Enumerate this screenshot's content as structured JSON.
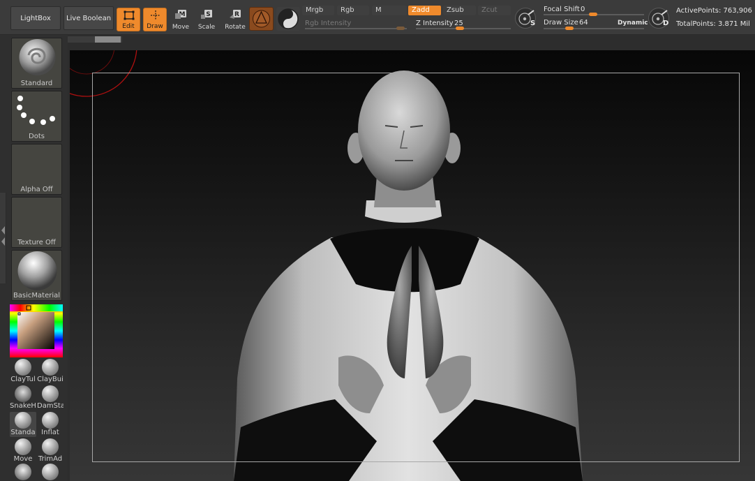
{
  "toolbar": {
    "lightbox": "LightBox",
    "live_boolean": "Live Boolean",
    "tools": [
      {
        "label": "Edit",
        "active": true
      },
      {
        "label": "Draw",
        "active": true
      },
      {
        "label": "Move",
        "active": false
      },
      {
        "label": "Scale",
        "active": false
      },
      {
        "label": "Rotate",
        "active": false
      }
    ],
    "modes": {
      "mrgb": "Mrgb",
      "rgb": "Rgb",
      "m": "M",
      "zadd": "Zadd",
      "zsub": "Zsub",
      "zcut": "Zcut"
    },
    "rgb_intensity_label": "Rgb Intensity",
    "z_intensity_label": "Z Intensity",
    "z_intensity_value": "25",
    "focal_shift_label": "Focal Shift",
    "focal_shift_value": "0",
    "draw_size_label": "Draw Size",
    "draw_size_value": "64",
    "dynamic_label": "Dynamic",
    "active_points": "ActivePoints: 763,906",
    "total_points": "TotalPoints: 3.871 Mil",
    "s_button": "S",
    "d_button": "D"
  },
  "shelf": {
    "brush": "Standard",
    "stroke": "Dots",
    "alpha": "Alpha Off",
    "texture": "Texture Off",
    "material": "BasicMaterial"
  },
  "brushes": [
    {
      "name": "ClayTul"
    },
    {
      "name": "ClayBui"
    },
    {
      "name": "SnakeH"
    },
    {
      "name": "DamSta"
    },
    {
      "name": "Standa"
    },
    {
      "name": "Inflat"
    },
    {
      "name": "Move"
    },
    {
      "name": "TrimAd"
    }
  ],
  "colors": {
    "accent": "#ef8a2c",
    "toolbar_bg": "#3b3b3b",
    "shelf_bg": "#2f2f2f",
    "canvas_bg": "#0a0a0a"
  }
}
